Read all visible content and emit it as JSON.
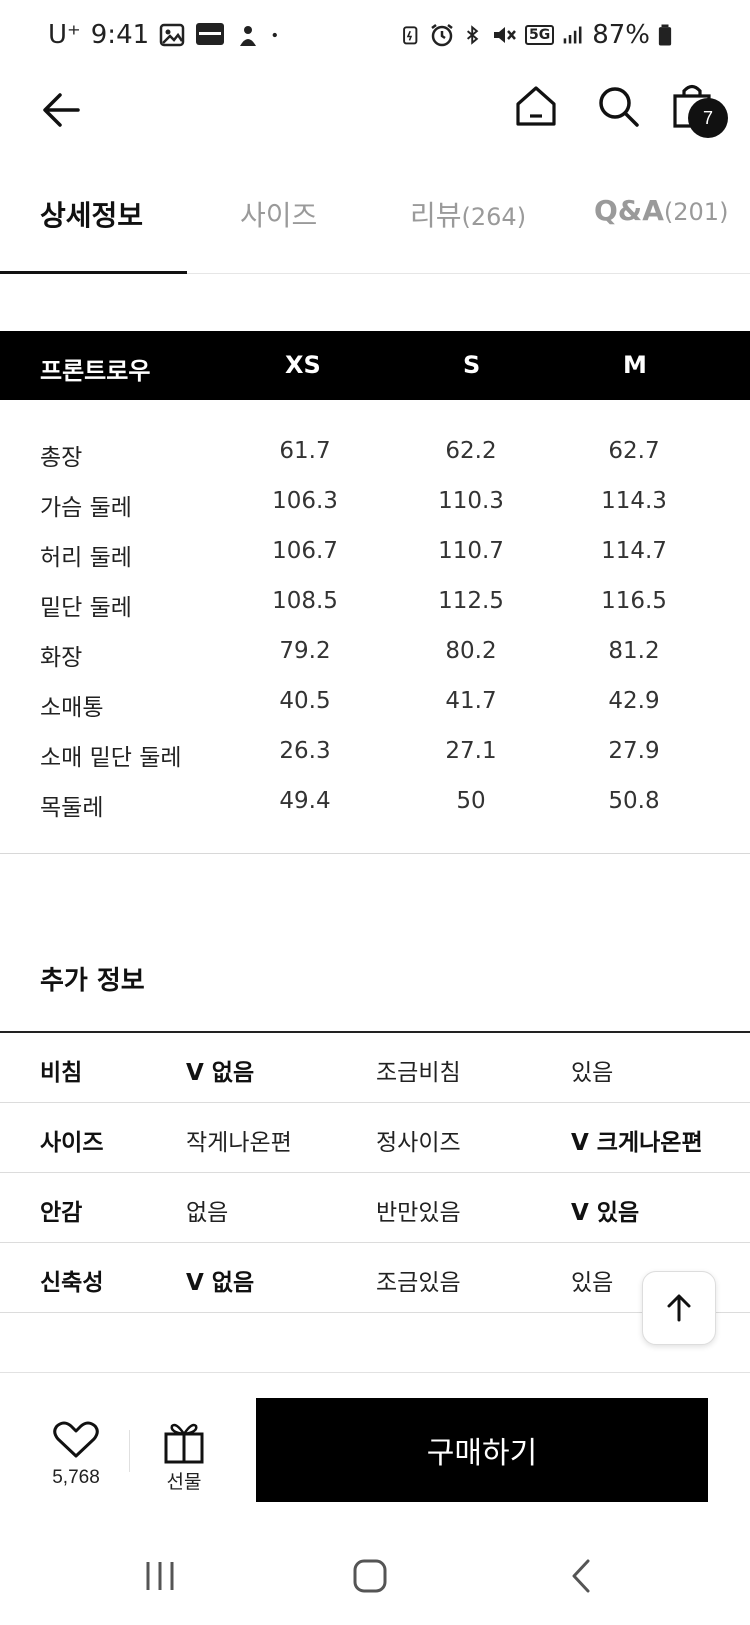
{
  "status_bar": {
    "carrier": "U⁺",
    "time": "9:41",
    "battery": "87%",
    "network": "5G",
    "left_icons": [
      "gallery-icon",
      "tmoney-icon",
      "app-icon",
      "dot-icon"
    ],
    "right_icons": [
      "battery-saver-icon",
      "alarm-icon",
      "bluetooth-icon",
      "mute-icon",
      "5g-icon",
      "signal-icon",
      "battery-icon"
    ]
  },
  "header": {
    "cart_count": "7"
  },
  "tabs": [
    {
      "label": "상세정보",
      "count": ""
    },
    {
      "label": "사이즈",
      "count": ""
    },
    {
      "label": "리뷰",
      "count": "(264)"
    },
    {
      "label": "Q&A",
      "count": "(201)"
    }
  ],
  "size_table": {
    "columns": [
      "프론트로우",
      "XS",
      "S",
      "M"
    ],
    "rows": [
      {
        "label": "총장",
        "values": [
          "61.7",
          "62.2",
          "62.7"
        ]
      },
      {
        "label": "가슴 둘레",
        "values": [
          "106.3",
          "110.3",
          "114.3"
        ]
      },
      {
        "label": "허리 둘레",
        "values": [
          "106.7",
          "110.7",
          "114.7"
        ]
      },
      {
        "label": "밑단 둘레",
        "values": [
          "108.5",
          "112.5",
          "116.5"
        ]
      },
      {
        "label": "화장",
        "values": [
          "79.2",
          "80.2",
          "81.2"
        ]
      },
      {
        "label": "소매통",
        "values": [
          "40.5",
          "41.7",
          "42.9"
        ]
      },
      {
        "label": "소매 밑단 둘레",
        "values": [
          "26.3",
          "27.1",
          "27.9"
        ]
      },
      {
        "label": "목둘레",
        "values": [
          "49.4",
          "50",
          "50.8"
        ]
      }
    ]
  },
  "extra_info": {
    "title": "추가 정보",
    "rows": [
      {
        "label": "비침",
        "options": [
          "V 없음",
          "조금비침",
          "있음"
        ],
        "selected": 0
      },
      {
        "label": "사이즈",
        "options": [
          "작게나온편",
          "정사이즈",
          "V 크게나온편"
        ],
        "selected": 2
      },
      {
        "label": "안감",
        "options": [
          "없음",
          "반만있음",
          "V 있음"
        ],
        "selected": 2
      },
      {
        "label": "신축성",
        "options": [
          "V 없음",
          "조금있음",
          "있음"
        ],
        "selected": 0
      }
    ]
  },
  "bottom_bar": {
    "like_count": "5,768",
    "gift_label": "선물",
    "buy_label": "구매하기"
  }
}
